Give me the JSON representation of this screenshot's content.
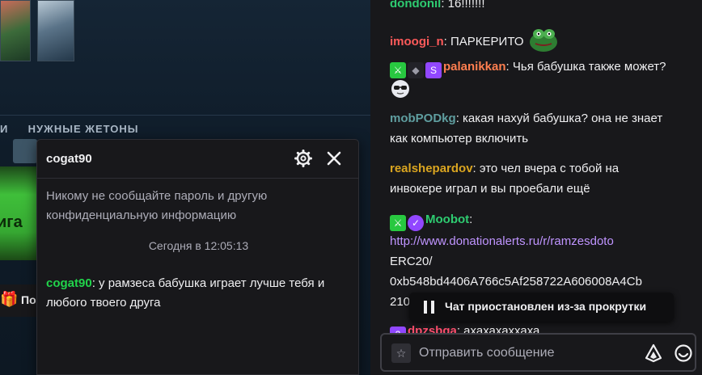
{
  "stream": {
    "tokens_label": "НУЖНЫЕ ЖЕТОНЫ",
    "tokens_lead": "И",
    "banner_text": "ига",
    "gift_label": "По"
  },
  "user_card": {
    "username": "cogat90",
    "warning": "Никому не сообщайте пароль и другую конфиденциальную информацию",
    "timestamp": "Сегодня в 12:05:13",
    "message_user": "cogat90",
    "message_text": ": у рамзеса бабушка играет лучше тебя и любого твоего друга"
  },
  "chat": {
    "messages": [
      {
        "user": "dondonil",
        "color": "#2ecc71",
        "text": ": 16!!!!!!!"
      },
      {
        "user": "imoogi_n",
        "color": "#ff5a5a",
        "text": ": ПАРКЕРИТО"
      },
      {
        "user": "palanikkan",
        "color": "#ff7f50",
        "text": ": Чья бабушка также может?"
      },
      {
        "user": "mobPODkg",
        "color": "#5f9ea0",
        "text": ": какая нахуй бабушка? она не знает как компьютер включить"
      },
      {
        "user": "realshepardov",
        "color": "#daa520",
        "text": ": это чел вчера с тобой на инвокере играл и вы проебали ещё"
      },
      {
        "user": "Moobot",
        "color": "#2ecc71",
        "text": ":"
      },
      {
        "user": "dpzsbga",
        "color": "#ff4f6e",
        "text": ": ахахахаххаха"
      }
    ],
    "moobot_link": "http://www.donationalerts.ru/r/ramzesdoto",
    "moobot_line2": "ERC20/",
    "moobot_line3": "0xb548bd4406A766c5Af258722A606008A4Cb",
    "moobot_line4": "210b0",
    "paused_text": "Чат приостановлен из-за прокрутки",
    "input_placeholder": "Отправить сообщение"
  },
  "colors": {
    "accent": "#9147ff",
    "background": "#18181b",
    "card_user": "#21d44b"
  },
  "icons": [
    "gear-icon",
    "close-icon",
    "pause-icon",
    "star-icon",
    "bits-icon",
    "emote-icon",
    "gift-icon"
  ]
}
